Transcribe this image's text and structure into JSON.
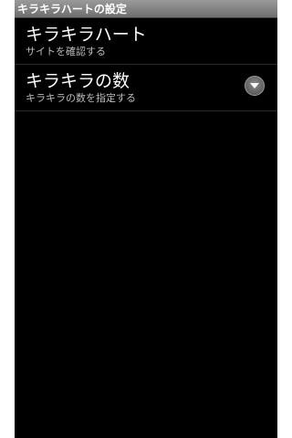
{
  "titlebar": {
    "title": "キラキラハートの設定"
  },
  "preferences": [
    {
      "title": "キラキラハート",
      "summary": "サイトを確認する"
    },
    {
      "title": "キラキラの数",
      "summary": "キラキラの数を指定する",
      "icon": "chevron-down-icon"
    }
  ]
}
